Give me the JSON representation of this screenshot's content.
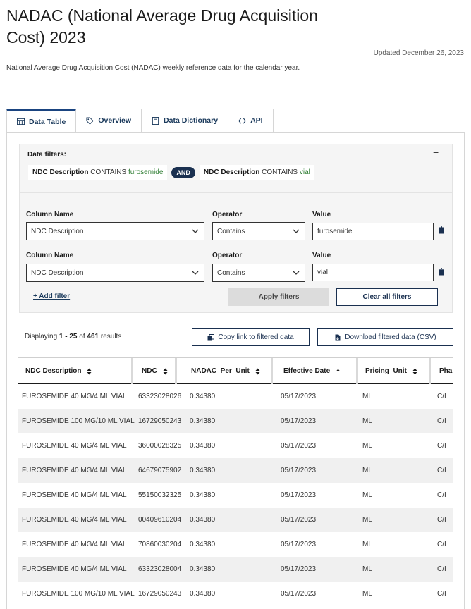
{
  "page": {
    "title": "NADAC (National Average Drug Acquisition Cost) 2023",
    "updated": "Updated December 26, 2023",
    "description": "National Average Drug Acquisition Cost (NADAC) weekly reference data for the calendar year."
  },
  "tabs": [
    {
      "label": "Data Table",
      "icon": "table-icon"
    },
    {
      "label": "Overview",
      "icon": "tag-icon"
    },
    {
      "label": "Data Dictionary",
      "icon": "book-icon"
    },
    {
      "label": "API",
      "icon": "code-icon"
    }
  ],
  "filters": {
    "heading": "Data filters:",
    "collapse_symbol": "−",
    "chip1": {
      "field": "NDC Description",
      "op": "CONTAINS",
      "value": "furosemide"
    },
    "and_label": "AND",
    "chip2": {
      "field": "NDC Description",
      "op": "CONTAINS",
      "value": "vial"
    },
    "column_label": "Column Name",
    "operator_label": "Operator",
    "value_label": "Value",
    "rows": [
      {
        "column": "NDC Description",
        "operator": "Contains",
        "value": "furosemide"
      },
      {
        "column": "NDC Description",
        "operator": "Contains",
        "value": "vial"
      }
    ],
    "add_filter": "+ Add filter",
    "apply": "Apply filters",
    "clear": "Clear all filters"
  },
  "results": {
    "prefix": "Displaying ",
    "range": "1 - 25",
    "of": " of ",
    "total": "461",
    "suffix": " results",
    "copy_link": "Copy link to filtered data",
    "download": "Download filtered data (CSV)"
  },
  "table": {
    "columns": [
      "NDC Description",
      "NDC",
      "NADAC_Per_Unit",
      "Effective Date",
      "Pricing_Unit",
      "Pha"
    ],
    "rows": [
      [
        "FUROSEMIDE 40 MG/4 ML VIAL",
        "63323028026",
        "0.34380",
        "05/17/2023",
        "ML",
        "C/I"
      ],
      [
        "FUROSEMIDE 100 MG/10 ML VIAL",
        "16729050243",
        "0.34380",
        "05/17/2023",
        "ML",
        "C/I"
      ],
      [
        "FUROSEMIDE 40 MG/4 ML VIAL",
        "36000028325",
        "0.34380",
        "05/17/2023",
        "ML",
        "C/I"
      ],
      [
        "FUROSEMIDE 40 MG/4 ML VIAL",
        "64679075902",
        "0.34380",
        "05/17/2023",
        "ML",
        "C/I"
      ],
      [
        "FUROSEMIDE 40 MG/4 ML VIAL",
        "55150032325",
        "0.34380",
        "05/17/2023",
        "ML",
        "C/I"
      ],
      [
        "FUROSEMIDE 40 MG/4 ML VIAL",
        "00409610204",
        "0.34380",
        "05/17/2023",
        "ML",
        "C/I"
      ],
      [
        "FUROSEMIDE 40 MG/4 ML VIAL",
        "70860030204",
        "0.34380",
        "05/17/2023",
        "ML",
        "C/I"
      ],
      [
        "FUROSEMIDE 40 MG/4 ML VIAL",
        "63323028004",
        "0.34380",
        "05/17/2023",
        "ML",
        "C/I"
      ],
      [
        "FUROSEMIDE 100 MG/10 ML VIAL",
        "16729050243",
        "0.34380",
        "05/17/2023",
        "ML",
        "C/I"
      ]
    ]
  },
  "colors": {
    "accent": "#1a4480",
    "navy": "#1a3050",
    "value_green": "#2e7d32"
  }
}
